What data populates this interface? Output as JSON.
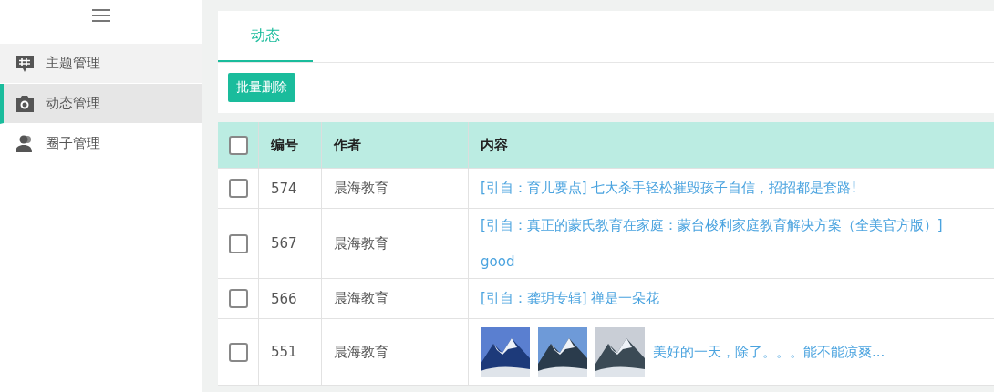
{
  "sidebar": {
    "items": [
      {
        "label": "主题管理",
        "kind": "topic",
        "selected": false
      },
      {
        "label": "动态管理",
        "kind": "camera",
        "selected": true
      },
      {
        "label": "圈子管理",
        "kind": "people",
        "selected": false
      }
    ]
  },
  "tabs": [
    {
      "label": "动态",
      "selected": true
    }
  ],
  "toolbar": {
    "button": "批量删除"
  },
  "table": {
    "select_all_checked": false,
    "columns": [
      "编号",
      "作者",
      "内容"
    ],
    "rows": [
      {
        "checked": false,
        "id": "574",
        "author": "晨海教育",
        "content": {
          "lines": [
            "[引自：育儿要点] 七大杀手轻松摧毁孩子自信，招招都是套路!"
          ]
        }
      },
      {
        "checked": false,
        "id": "567",
        "author": "晨海教育",
        "content": {
          "lines": [
            "[引自：真正的蒙氏教育在家庭：蒙台梭利家庭教育解决方案（全美官方版）]",
            "good"
          ]
        }
      },
      {
        "checked": false,
        "id": "566",
        "author": "晨海教育",
        "content": {
          "lines": [
            "[引自：龚玥专辑] 禅是一朵花"
          ]
        }
      },
      {
        "checked": false,
        "id": "551",
        "author": "晨海教育",
        "content": {
          "media": [
            {
              "kind": "picture"
            },
            {
              "kind": "picture"
            },
            {
              "kind": "picture"
            }
          ],
          "lines": [
            "美好的一天，除了。。。能不能凉爽..."
          ]
        }
      }
    ]
  }
}
